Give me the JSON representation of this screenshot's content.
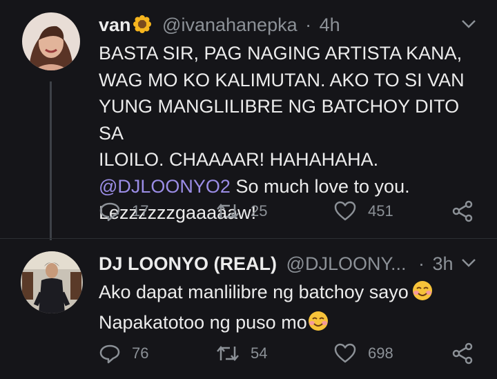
{
  "tweets": [
    {
      "name": "van",
      "handle": "@ivanahanepka",
      "separator": "·",
      "time": "4h",
      "body_lines": [
        "BASTA SIR, PAG NAGING ARTISTA KANA,",
        "WAG MO KO KALIMUTAN. AKO TO SI VAN",
        "YUNG MANGLILIBRE NG BATCHOY DITO SA",
        "ILOILO. CHAAAAR! HAHAHAHA."
      ],
      "mention": "@DJLOONYO2",
      "mention_rest": " So much love to you.",
      "last_line": "Lezzzzzzgaaaaaw!",
      "reply_count": "17",
      "retweet_count": "25",
      "like_count": "451"
    },
    {
      "name": "DJ LOONYO (REAL)",
      "handle": "@DJLOONY...",
      "separator": "·",
      "time": "3h",
      "line1": "Ako dapat manlilibre ng batchoy sayo",
      "line2": "Napakatotoo ng puso mo",
      "reply_count": "76",
      "retweet_count": "54",
      "like_count": "698"
    }
  ],
  "colors": {
    "background": "#151519",
    "text": "#ececec",
    "muted": "#8c9197",
    "mention": "#9b8de6",
    "thread_line": "#3d4147"
  },
  "icons": [
    "sunflower-emoji",
    "chevron-down-icon",
    "reply-icon",
    "retweet-icon",
    "like-icon",
    "share-icon",
    "smiling-face-emoji"
  ]
}
